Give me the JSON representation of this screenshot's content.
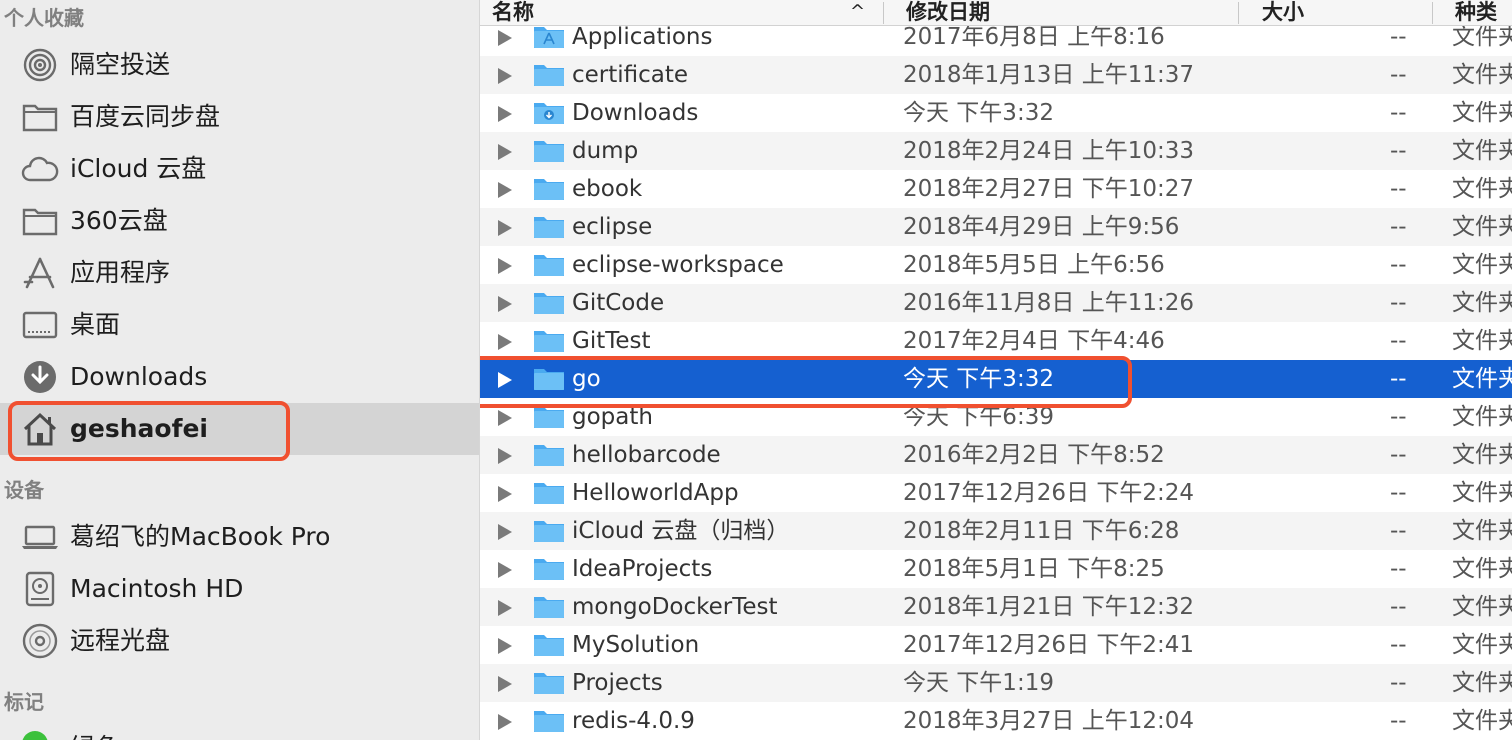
{
  "sidebar": {
    "sections": {
      "favorites": "个人收藏",
      "devices": "设备",
      "tags": "标记"
    },
    "favorites": [
      {
        "label": "隔空投送",
        "icon": "airdrop-icon"
      },
      {
        "label": "百度云同步盘",
        "icon": "folder-icon"
      },
      {
        "label": "iCloud 云盘",
        "icon": "cloud-icon"
      },
      {
        "label": "360云盘",
        "icon": "folder-icon"
      },
      {
        "label": "应用程序",
        "icon": "applications-icon"
      },
      {
        "label": "桌面",
        "icon": "desktop-icon"
      },
      {
        "label": "Downloads",
        "icon": "download-icon"
      },
      {
        "label": "geshaofei",
        "icon": "home-icon",
        "selected": true
      }
    ],
    "devices": [
      {
        "label": "葛绍飞的MacBook Pro",
        "icon": "laptop-icon"
      },
      {
        "label": "Macintosh HD",
        "icon": "hard-disk-icon"
      },
      {
        "label": "远程光盘",
        "icon": "optical-disc-icon"
      }
    ],
    "tags": [
      {
        "label": "绿色",
        "color": "#3cc13c"
      }
    ]
  },
  "header": {
    "name": "名称",
    "date": "修改日期",
    "size": "大小",
    "kind": "种类",
    "sort_indicator": "^"
  },
  "files": [
    {
      "name": "Applications",
      "date": "2017年6月8日 上午8:16",
      "size": "--",
      "kind": "文件夹",
      "icon": "applications-folder-icon"
    },
    {
      "name": "certificate",
      "date": "2018年1月13日 上午11:37",
      "size": "--",
      "kind": "文件夹",
      "icon": "folder-icon"
    },
    {
      "name": "Downloads",
      "date": "今天 下午3:32",
      "size": "--",
      "kind": "文件夹",
      "icon": "downloads-folder-icon"
    },
    {
      "name": "dump",
      "date": "2018年2月24日 上午10:33",
      "size": "--",
      "kind": "文件夹",
      "icon": "folder-icon"
    },
    {
      "name": "ebook",
      "date": "2018年2月27日 下午10:27",
      "size": "--",
      "kind": "文件夹",
      "icon": "folder-icon"
    },
    {
      "name": "eclipse",
      "date": "2018年4月29日 上午9:56",
      "size": "--",
      "kind": "文件夹",
      "icon": "folder-icon"
    },
    {
      "name": "eclipse-workspace",
      "date": "2018年5月5日 上午6:56",
      "size": "--",
      "kind": "文件夹",
      "icon": "folder-icon"
    },
    {
      "name": "GitCode",
      "date": "2016年11月8日 上午11:26",
      "size": "--",
      "kind": "文件夹",
      "icon": "folder-icon"
    },
    {
      "name": "GitTest",
      "date": "2017年2月4日 下午4:46",
      "size": "--",
      "kind": "文件夹",
      "icon": "folder-icon"
    },
    {
      "name": "go",
      "date": "今天 下午3:32",
      "size": "--",
      "kind": "文件夹",
      "icon": "folder-icon",
      "selected": true
    },
    {
      "name": "gopath",
      "date": "今天 下午6:39",
      "size": "--",
      "kind": "文件夹",
      "icon": "folder-icon"
    },
    {
      "name": "hellobarcode",
      "date": "2016年2月2日 下午8:52",
      "size": "--",
      "kind": "文件夹",
      "icon": "folder-icon"
    },
    {
      "name": "HelloworldApp",
      "date": "2017年12月26日 下午2:24",
      "size": "--",
      "kind": "文件夹",
      "icon": "folder-icon"
    },
    {
      "name": "iCloud 云盘（归档）",
      "date": "2018年2月11日 下午6:28",
      "size": "--",
      "kind": "文件夹",
      "icon": "folder-icon"
    },
    {
      "name": "IdeaProjects",
      "date": "2018年5月1日 下午8:25",
      "size": "--",
      "kind": "文件夹",
      "icon": "folder-icon"
    },
    {
      "name": "mongoDockerTest",
      "date": "2018年1月21日 下午12:32",
      "size": "--",
      "kind": "文件夹",
      "icon": "folder-icon"
    },
    {
      "name": "MySolution",
      "date": "2017年12月26日 下午2:41",
      "size": "--",
      "kind": "文件夹",
      "icon": "folder-icon"
    },
    {
      "name": "Projects",
      "date": "今天 下午1:19",
      "size": "--",
      "kind": "文件夹",
      "icon": "folder-icon"
    },
    {
      "name": "redis-4.0.9",
      "date": "2018年3月27日 上午12:04",
      "size": "--",
      "kind": "文件夹",
      "icon": "folder-icon"
    }
  ],
  "colors": {
    "selection": "#1560d0",
    "highlight_outline": "#f05030",
    "folder": "#5db8f0",
    "sidebar_bg": "#ececec"
  }
}
